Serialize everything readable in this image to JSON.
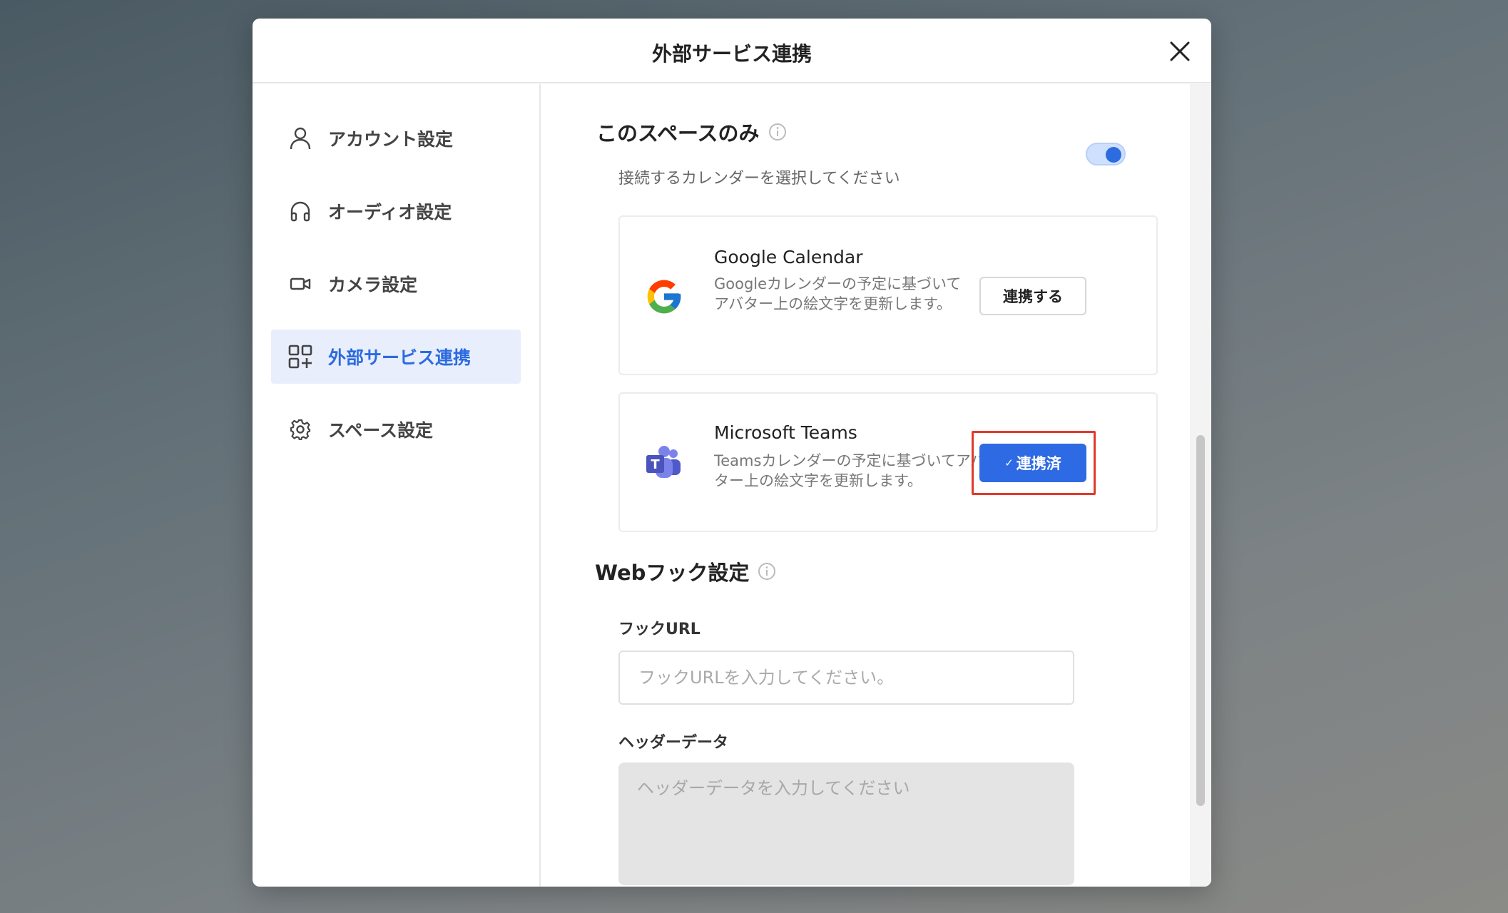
{
  "modal": {
    "title": "外部サービス連携"
  },
  "sidebar": {
    "items": [
      {
        "label": "アカウント設定",
        "icon": "user-icon"
      },
      {
        "label": "オーディオ設定",
        "icon": "headphones-icon"
      },
      {
        "label": "カメラ設定",
        "icon": "camera-icon"
      },
      {
        "label": "外部サービス連携",
        "icon": "integrations-icon",
        "active": true
      },
      {
        "label": "スペース設定",
        "icon": "gear-icon"
      }
    ]
  },
  "calendar": {
    "title": "このスペースのみ",
    "toggle_on": true,
    "subtitle": "接続するカレンダーを選択してください",
    "services": [
      {
        "name": "Google Calendar",
        "description": "Googleカレンダーの予定に基づいてアバター上の絵文字を更新します。",
        "button_label": "連携する",
        "connected": false
      },
      {
        "name": "Microsoft Teams",
        "description": "Teamsカレンダーの予定に基づいてアバター上の絵文字を更新します。",
        "button_label": "連携済",
        "button_check": "✓",
        "connected": true
      }
    ]
  },
  "webhook": {
    "title": "Webフック設定",
    "url_label": "フックURL",
    "url_placeholder": "フックURLを入力してください。",
    "header_label": "ヘッダーデータ",
    "header_placeholder": "ヘッダーデータを入力してください"
  },
  "colors": {
    "accent": "#2e6ae3",
    "active_nav_bg": "#e8eefb",
    "highlight": "#e0392b"
  }
}
